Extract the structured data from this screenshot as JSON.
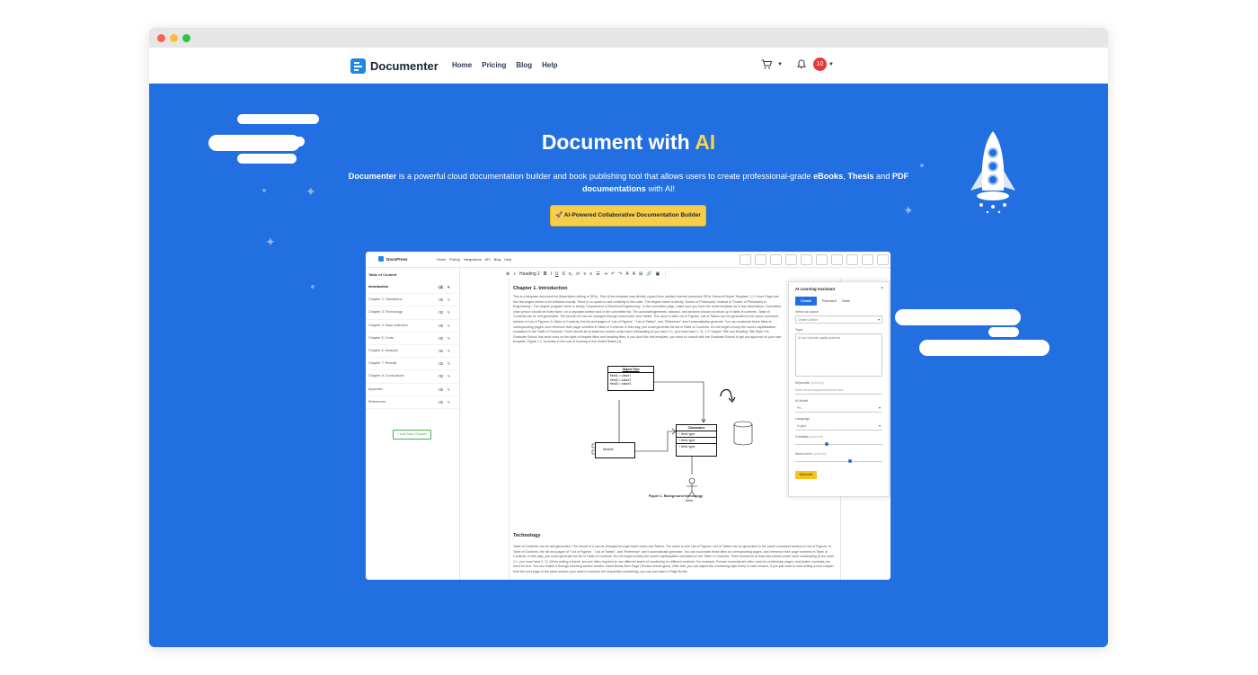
{
  "browser": {
    "brand": "Documenter"
  },
  "nav": {
    "links": [
      "Home",
      "Pricing",
      "Blog",
      "Help"
    ],
    "notification_count": "10"
  },
  "hero": {
    "title_main": "Document with ",
    "title_accent": "AI",
    "desc_brand": "Documenter",
    "desc_text1": " is a powerful cloud documentation builder and book publishing tool that allows users to create professional-grade ",
    "desc_ebooks": "eBooks",
    "desc_comma": ", ",
    "desc_thesis": "Thesis",
    "desc_and": " and ",
    "desc_pdf": "PDF documentations",
    "desc_end": " with AI!",
    "cta_label": "AI-Powered Collaborative Documentation Builder"
  },
  "app": {
    "brand": "DocoPress",
    "links": [
      "Home",
      "Pricing",
      "Integrations",
      "API",
      "Blog",
      "Help"
    ],
    "toc_title": "Table of Content",
    "toc_items": [
      "Introduction",
      "Chapter 2: Operations",
      "Chapter 3: Technology",
      "Chapter 4: Data collection",
      "Chapter 5: Code",
      "Chapter 6: Analysis",
      "Chapter 7: Results",
      "Chapter 8: Conclusions",
      "Appendix",
      "References"
    ],
    "add_chapter": "+ Add New Chapter",
    "toolbar_style": "Heading 2",
    "editor": {
      "heading": "Chapter 1. Introduction",
      "para": "This is a template document for dissertation writing in SEAL. Part of the template was directly copied from another internal document SEAL General Report Template. 1.1 Cover Page and first few pages needs to be followed exactly. There is no space to use creativity in this case. The degree name is strictly \"Doctor of Philosophy\" instead of \"Doctor of Philosophy in Engineering\". The degree program name is strictly \"Department of Electrical Engineering\". In the committee page, make sure you have the exact template as in this dissertation. Committee chair person should be listed twice, on a separate section and in the committee list. The acknowledgements, abstract, and sections should not show up in table of contents. Table of Contents can be self-generated. The format of it can be changed through Insert-Index and Tables. The same is with List of Figures. List of Tables can be generated in the same command window of List of Figures. In Table of Contents, the list and pages of \"List of Figures\", \"List of Tables\", and \"Reference\" won't automatically generate. You can bookmark these titles at corresponding pages, and reference their page numbers in Table of Contents. In this way, you could generate the list in Table of Contents. Do not forget to keep the word's capitalization consistent in the Table of Contents. There should be at least two entries under each subheading (if you have 2.1, you must have 2. 2). 1.2 Chapter Title and Heading Title Style The Graduate School has strict rules on the style of chapter titles and heading titles. If you don't like this template, you need to consult with the Graduate School to get pre-approval on your own template. Figure 1.1. Increase in the cost of housing in the United States [1].",
      "uml_object_title": "Object Two",
      "uml_object_fields": [
        "field1 = value1",
        "field2 = value2",
        "field3 = value3"
      ],
      "uml_class_title": "Classname",
      "uml_class_fields": [
        "+ field: type",
        "+ field: type",
        "+ field: type"
      ],
      "uml_module": "Module",
      "uml_actor": "Actor",
      "figure_caption": "Figure 1. Background technology",
      "heading2": "Technology",
      "para2": "Table of Contents can be self-generated. The format of it can be changed through Insert-Index and Tables. The same is with List of Figures. List of Tables can be generated in the same command window of List of Figures. In Table of Contents, the list and pages of \"List of Figures\", \"List of Tables\", and \"Reference\" won't automatically generate. You can bookmark these titles at corresponding pages, and reference their page numbers in Table of Contents. In this way, you could generate the list in Table of Contents. Do not forget to keep the word's capitalization consistent in the Table of Contents. There should be at least two entries under each subheading (if you have 2.1, you must have 2. 2). When writing a thesis, you are often required to use different styles of numbering for different sections. For example, Roman numerals are often used for preliminary pages, and Arabic numerals are used for text. You can realize it through inserting section breaks: Insert-Break-Next Page (Section break types). After that, you can adjust the numbering style freely in each section. If you just want to start writing a new chapter from the next page in the same section (you want to continue the sequential numbering), you can just insert a Page Break."
    },
    "ai": {
      "title": "AI Learning Assistant",
      "close": "×",
      "tabs": [
        "Create",
        "Research",
        "Stats"
      ],
      "select_option_label": "Select an option",
      "select_option_value": "Create Content",
      "topic_label": "Topic",
      "topic_value": "AI tool of private quality problems",
      "keywords_label": "Keywords",
      "keywords_optional": "(optional)",
      "keywords_placeholder": "Write relevant keywords/phrases here",
      "model_label": "AI Model",
      "model_value": "Pro",
      "language_label": "Language",
      "language_value": "English",
      "creativity_label": "Creativity",
      "creativity_optional": "(optional)",
      "creativity_level": 0.35,
      "wordcount_label": "Word count",
      "wordcount_optional": "(optional)",
      "wordcount_level": 0.62,
      "generate": "Generate"
    }
  }
}
